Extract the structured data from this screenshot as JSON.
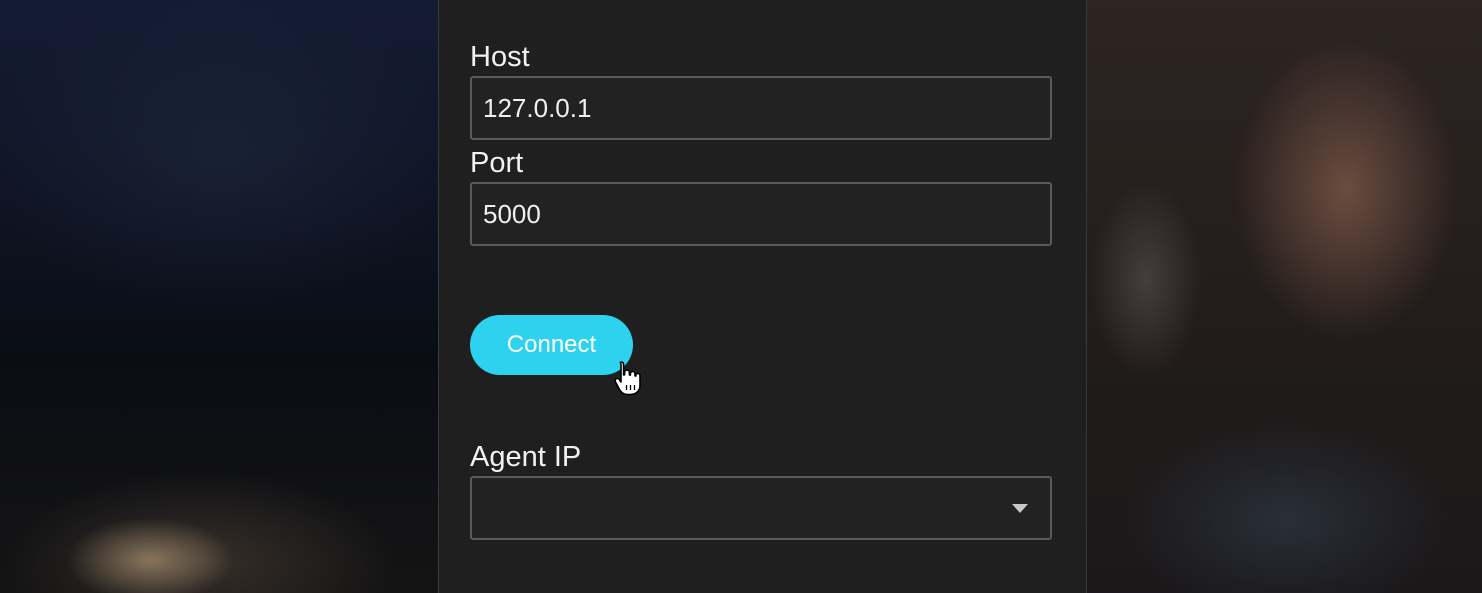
{
  "form": {
    "host_label": "Host",
    "host_value": "127.0.0.1",
    "port_label": "Port",
    "port_value": "5000",
    "connect_label": "Connect",
    "agent_ip_label": "Agent IP",
    "agent_ip_value": ""
  },
  "colors": {
    "accent": "#2dd3ee",
    "panel_bg": "#1f1f20",
    "field_border": "#5a5a5c",
    "text": "#f2f2f2"
  },
  "icons": {
    "cursor": "hand-pointer-icon",
    "dropdown": "caret-down-icon"
  }
}
